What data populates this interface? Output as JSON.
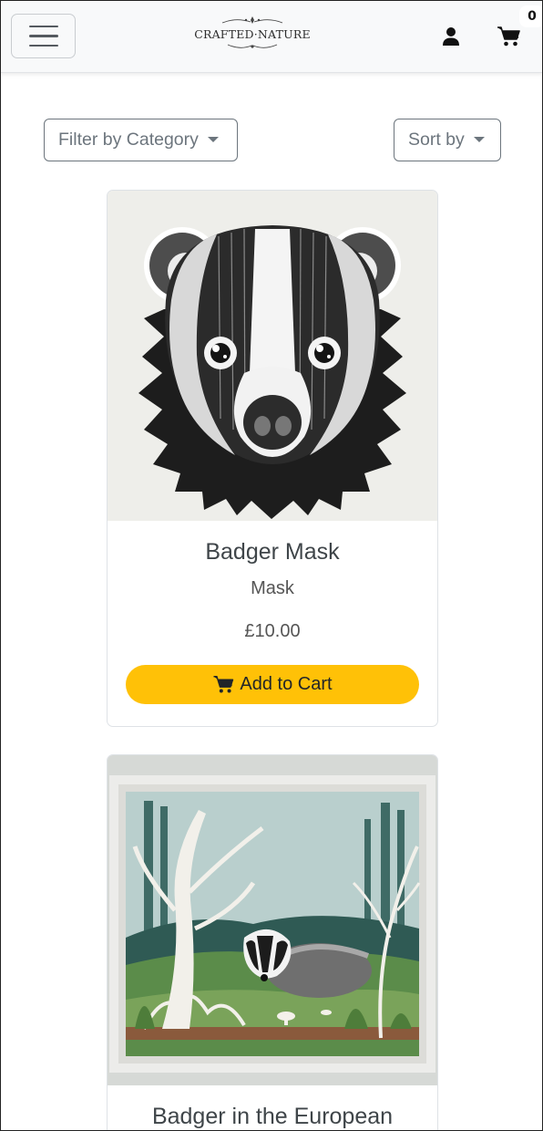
{
  "header": {
    "menu_icon": "hamburger-menu-icon",
    "logo_text": "CRAFTED·NATURE",
    "user_icon": "user-icon",
    "cart_icon": "shopping-cart-icon",
    "cart_count": "0"
  },
  "toolbar": {
    "filter_label": "Filter by Category",
    "sort_label": "Sort by"
  },
  "products": [
    {
      "name": "Badger Mask",
      "category": "Mask",
      "price": "£10.00",
      "add_to_cart_label": "Add to Cart",
      "image": "paper-craft-badger-face"
    },
    {
      "name": "Badger in the European",
      "image": "paper-craft-badger-forest-scene"
    }
  ],
  "colors": {
    "accent": "#ffc107",
    "navbar_bg": "#f8f9fa"
  }
}
